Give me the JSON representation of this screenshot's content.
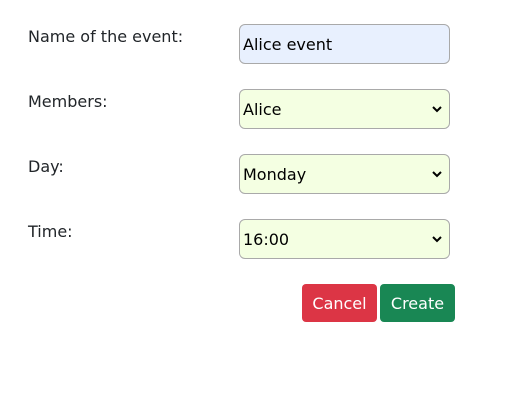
{
  "form": {
    "name": {
      "label": "Name of the event:",
      "value": "Alice event"
    },
    "members": {
      "label": "Members:",
      "selected": "Alice"
    },
    "day": {
      "label": "Day:",
      "selected": "Monday"
    },
    "time": {
      "label": "Time:",
      "selected": "16:00"
    }
  },
  "actions": {
    "cancel_label": "Cancel",
    "create_label": "Create"
  },
  "colors": {
    "input_bg": "#e8f0fe",
    "select_bg": "#f4ffe2",
    "cancel": "#dc3545",
    "create": "#198754"
  },
  "icons": {
    "select_arrow": "chevron-down-icon"
  }
}
